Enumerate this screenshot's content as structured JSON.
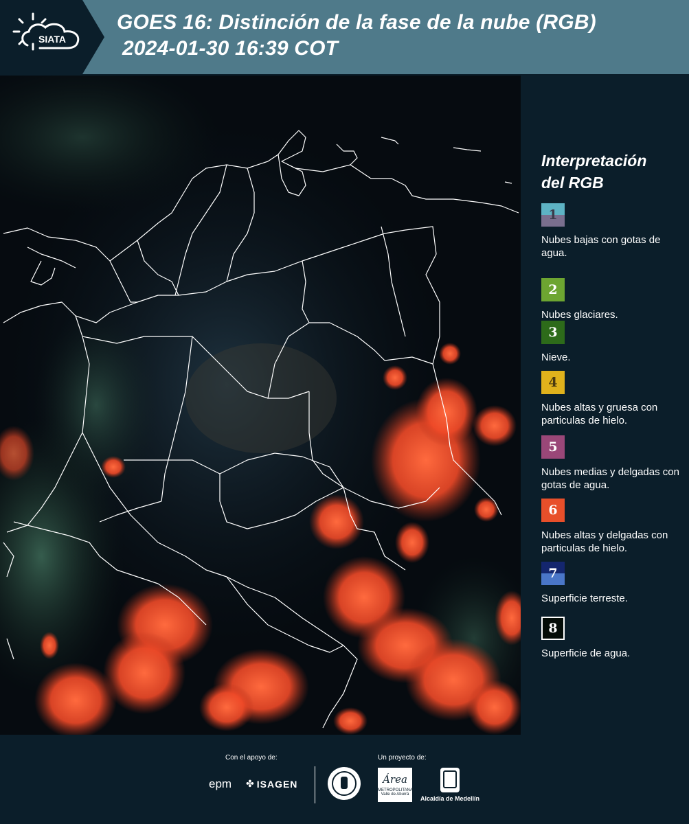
{
  "header": {
    "logo_text": "SIATA",
    "title_line1": "GOES 16: Distinción de la fase de la nube (RGB)",
    "title_line2": "2024-01-30 16:39 COT"
  },
  "legend": {
    "title_line1": "Interpretación",
    "title_line2": "del RGB",
    "items": [
      {
        "number": "1",
        "label": "Nubes bajas con gotas de agua.",
        "color_top": "#5eb3c4",
        "color_bottom": "#7a6f8e",
        "num_color": "#3b3b4a"
      },
      {
        "number": "2",
        "label": "Nubes glaciares.",
        "color": "#6da531",
        "num_color": "#ffffff"
      },
      {
        "number": "3",
        "label": "Nieve.",
        "color": "#2d6b1a",
        "num_color": "#ffffff"
      },
      {
        "number": "4",
        "label": "Nubes altas y gruesa con particulas de hielo.",
        "color": "#e0b21c",
        "num_color": "#4a3a10"
      },
      {
        "number": "5",
        "label": "Nubes medias y delgadas con gotas de agua.",
        "color": "#9a4778",
        "num_color": "#ffffff"
      },
      {
        "number": "6",
        "label": "Nubes altas y delgadas con particulas de hielo.",
        "color": "#e84f2a",
        "num_color": "#ffffff"
      },
      {
        "number": "7",
        "label": "Superficie terreste.",
        "color_top": "#14266e",
        "color_bottom": "#4a76c8",
        "num_color": "#ffffff"
      },
      {
        "number": "8",
        "label": "Superficie de agua.",
        "color": "#040c07",
        "num_color": "#ffffff",
        "border": "#ffffff"
      }
    ]
  },
  "footer": {
    "support_label": "Con el apoyo de:",
    "project_label": "Un proyecto de:",
    "sponsors": [
      "epm",
      "ISAGEN"
    ],
    "area_logo_text": "Área",
    "area_subtext": "METROPOLITANA",
    "area_subtext2": "Valle de Aburrá",
    "alcaldia_text": "Alcaldía de Medellín"
  },
  "colors": {
    "header_bg": "#4f7a8a",
    "page_bg": "#0b1e2a",
    "cloud_ice": "#ff5a32"
  }
}
